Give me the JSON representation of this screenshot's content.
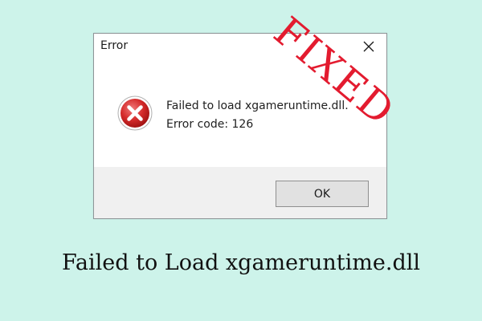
{
  "dialog": {
    "title": "Error",
    "close_icon": "close-icon",
    "icon": "error-icon",
    "message_line1": "Failed to load xgameruntime.dll.",
    "message_line2": "Error code: 126",
    "ok_label": "OK"
  },
  "stamp": {
    "text": "FIXED",
    "color": "#e31b2f"
  },
  "caption": "Failed to Load xgameruntime.dll",
  "colors": {
    "background": "#cdf3ea",
    "error_red": "#d42a2a"
  }
}
